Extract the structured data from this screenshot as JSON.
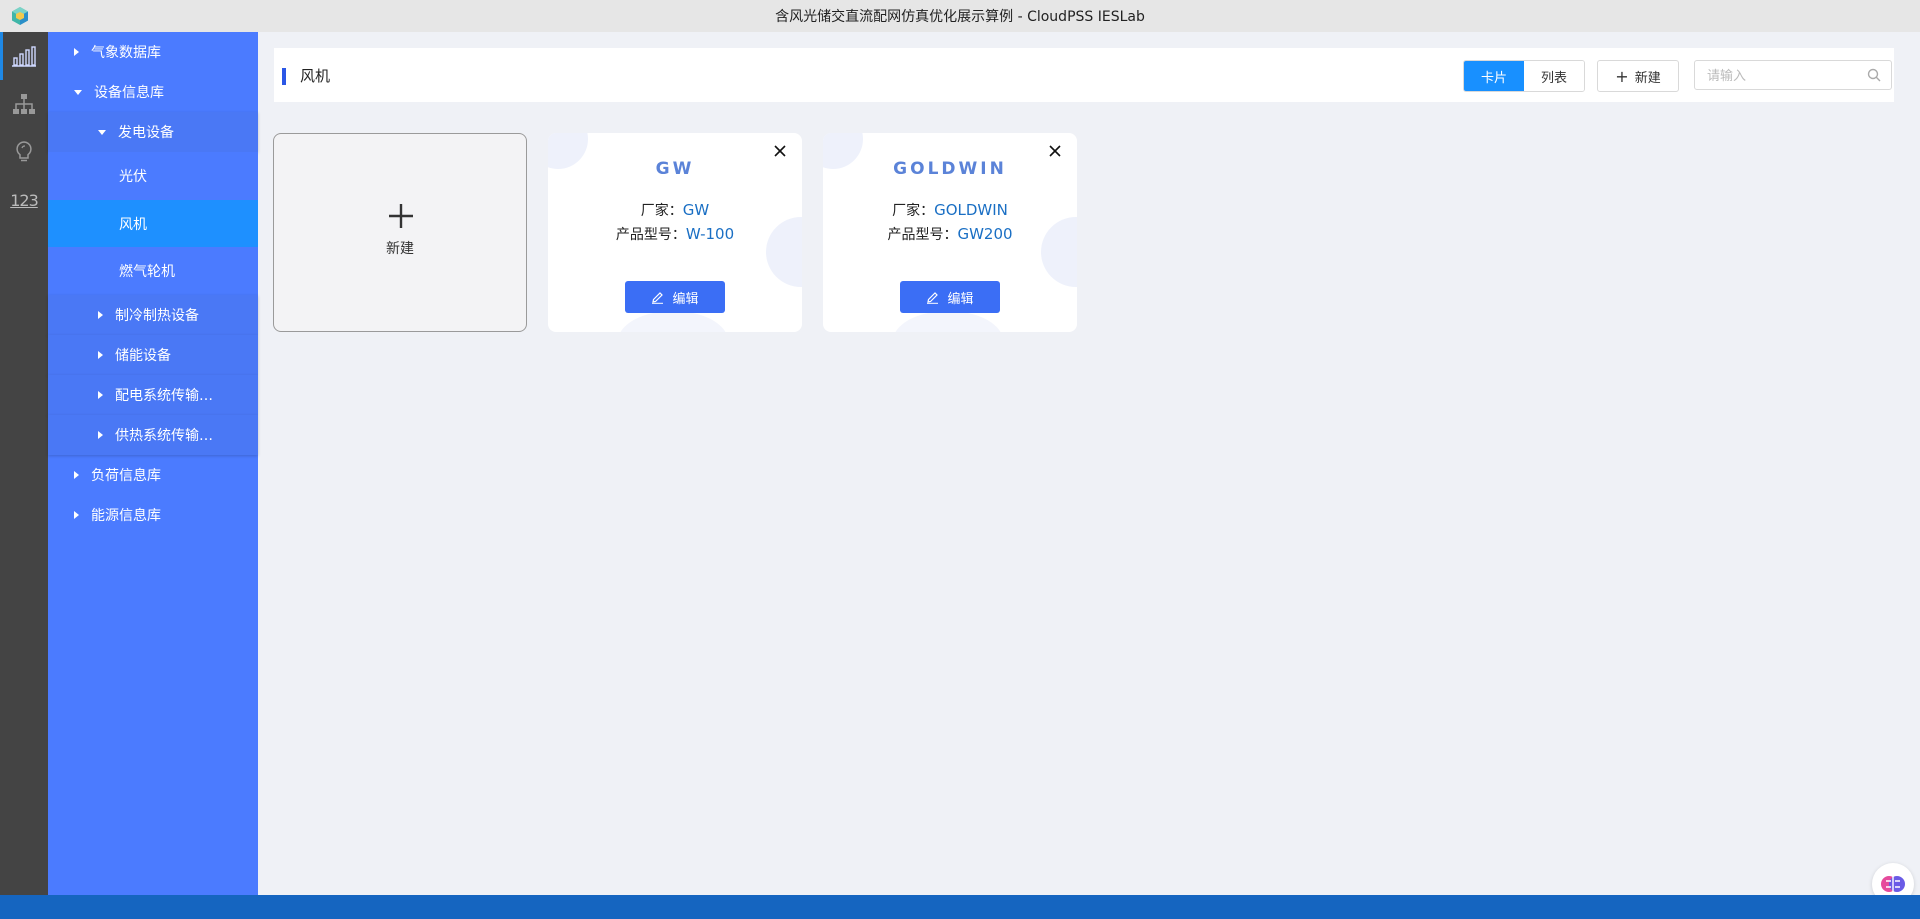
{
  "window": {
    "title": "含风光储交直流配网仿真优化展示算例 - CloudPSS IESLab"
  },
  "rail": {
    "items": [
      {
        "icon": "bar-chart-icon",
        "active": true
      },
      {
        "icon": "hierarchy-icon",
        "active": false
      },
      {
        "icon": "lightbulb-icon",
        "active": false
      },
      {
        "icon": "numbers-icon",
        "label": "123",
        "active": false
      }
    ]
  },
  "tree": {
    "items": [
      {
        "label": "气象数据库",
        "expanded": false
      },
      {
        "label": "设备信息库",
        "expanded": true
      },
      {
        "label": "发电设备",
        "expanded": true
      },
      {
        "label": "光伏"
      },
      {
        "label": "风机",
        "selected": true
      },
      {
        "label": "燃气轮机"
      },
      {
        "label": "制冷制热设备",
        "expanded": false
      },
      {
        "label": "储能设备",
        "expanded": false
      },
      {
        "label": "配电系统传输…",
        "expanded": false
      },
      {
        "label": "供热系统传输…",
        "expanded": false
      },
      {
        "label": "负荷信息库",
        "expanded": false
      },
      {
        "label": "能源信息库",
        "expanded": false
      }
    ]
  },
  "header": {
    "title": "风机",
    "view_toggle": [
      {
        "label": "卡片",
        "active": true
      },
      {
        "label": "列表",
        "active": false
      }
    ],
    "new_label": "新建",
    "search_placeholder": "请输入"
  },
  "cards": {
    "new_label": "新建",
    "items": [
      {
        "name": "GW",
        "vendor_label": "厂家：",
        "vendor": "GW",
        "model_label": "产品型号：",
        "model": "W-100",
        "edit_label": "编辑"
      },
      {
        "name": "GOLDWIN",
        "vendor_label": "厂家：",
        "vendor": "GOLDWIN",
        "model_label": "产品型号：",
        "model": "GW200",
        "edit_label": "编辑"
      }
    ]
  },
  "colors": {
    "sidebar": "#4b7bff",
    "selected": "#1e90ff",
    "accent": "#1890ff",
    "button": "#3b6ef5"
  }
}
